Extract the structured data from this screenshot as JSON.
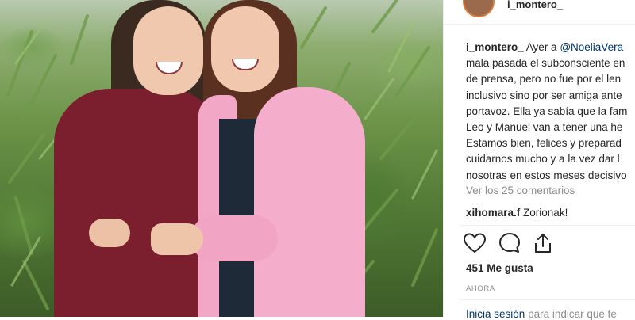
{
  "header": {
    "username": "i_montero_"
  },
  "post": {
    "caption_user": "i_montero_",
    "caption_lines": [
      {
        "pre": "Ayer a ",
        "mention": "@NoeliaVera"
      },
      {
        "text": "mala pasada el subconsciente en"
      },
      {
        "text": "de prensa, pero no fue por el len"
      },
      {
        "text": "inclusivo sino por ser amiga ante"
      },
      {
        "text": "portavoz. Ella ya sabía que la fam"
      },
      {
        "text": "Leo y Manuel van a tener una he"
      },
      {
        "text": "Estamos bien, felices y preparad"
      },
      {
        "text": "cuidarnos mucho y a la vez dar l"
      },
      {
        "text": "nosotras en estos meses decisivo"
      }
    ],
    "view_comments": "Ver los 25 comentarios",
    "comments": [
      {
        "user": "xihomara.f",
        "text": "Zorionak!"
      }
    ],
    "likes": "451 Me gusta",
    "time": "AHORA"
  },
  "footer": {
    "login_link": "Inicia sesión",
    "login_text": "para indicar que te"
  },
  "icons": {
    "like": "heart-icon",
    "comment": "comment-icon",
    "share": "share-icon"
  },
  "colors": {
    "link": "#00376b",
    "muted": "#8e8e8e",
    "text": "#262626",
    "avatar_ring": "#e07b39"
  }
}
